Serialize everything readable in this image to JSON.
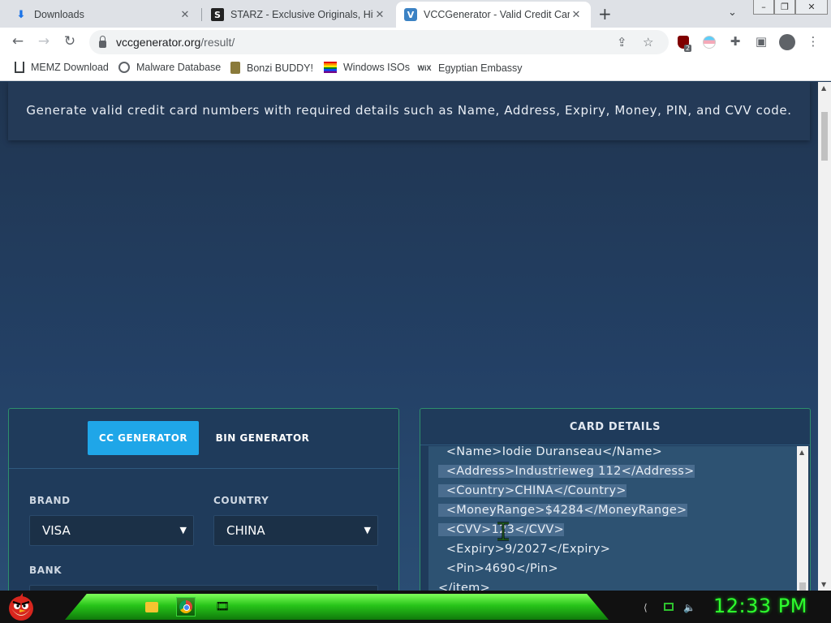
{
  "browser": {
    "tabs": [
      {
        "title": "Downloads",
        "icon": "download-icon"
      },
      {
        "title": "STARZ - Exclusive Originals, Hit Movies",
        "icon": "starz-icon"
      },
      {
        "title": "VCCGenerator - Valid Credit Card",
        "icon": "vcc-icon"
      }
    ],
    "new_tab": "+",
    "url_host": "vccgenerator.org",
    "url_path": "/result/",
    "extension_badge": "2",
    "bookmarks": [
      {
        "label": "MEMZ Download"
      },
      {
        "label": "Malware Database"
      },
      {
        "label": "Bonzi BUDDY!"
      },
      {
        "label": "Windows ISOs"
      },
      {
        "label": "Egyptian Embassy"
      }
    ]
  },
  "page": {
    "hero_text": "Generate valid credit card numbers with required details such as Name, Address, Expiry, Money, PIN, and CVV code.",
    "generator": {
      "tab_cc": "CC GENERATOR",
      "tab_bin": "BIN GENERATOR",
      "brand_label": "BRAND",
      "brand_value": "VISA",
      "country_label": "COUNTRY",
      "country_value": "CHINA",
      "bank_label": "BANK"
    },
    "card_details": {
      "title": "CARD DETAILS",
      "lines": [
        "  <Name>Iodie Duranseau</Name>",
        "  <Address>Industrieweg 112</Address>",
        "  <Country>CHINA</Country>",
        "  <MoneyRange>$4284</MoneyRange>",
        "  <CVV>123</CVV>",
        "  <Expiry>9/2027</Expiry>",
        "  <Pin>4690</Pin>",
        "</item>"
      ]
    }
  },
  "taskbar": {
    "clock": "12:33 PM"
  },
  "colors": {
    "accent_button": "#1fa6e8",
    "panel_border": "#2e8f6c",
    "clock_green": "#2eff2e"
  }
}
